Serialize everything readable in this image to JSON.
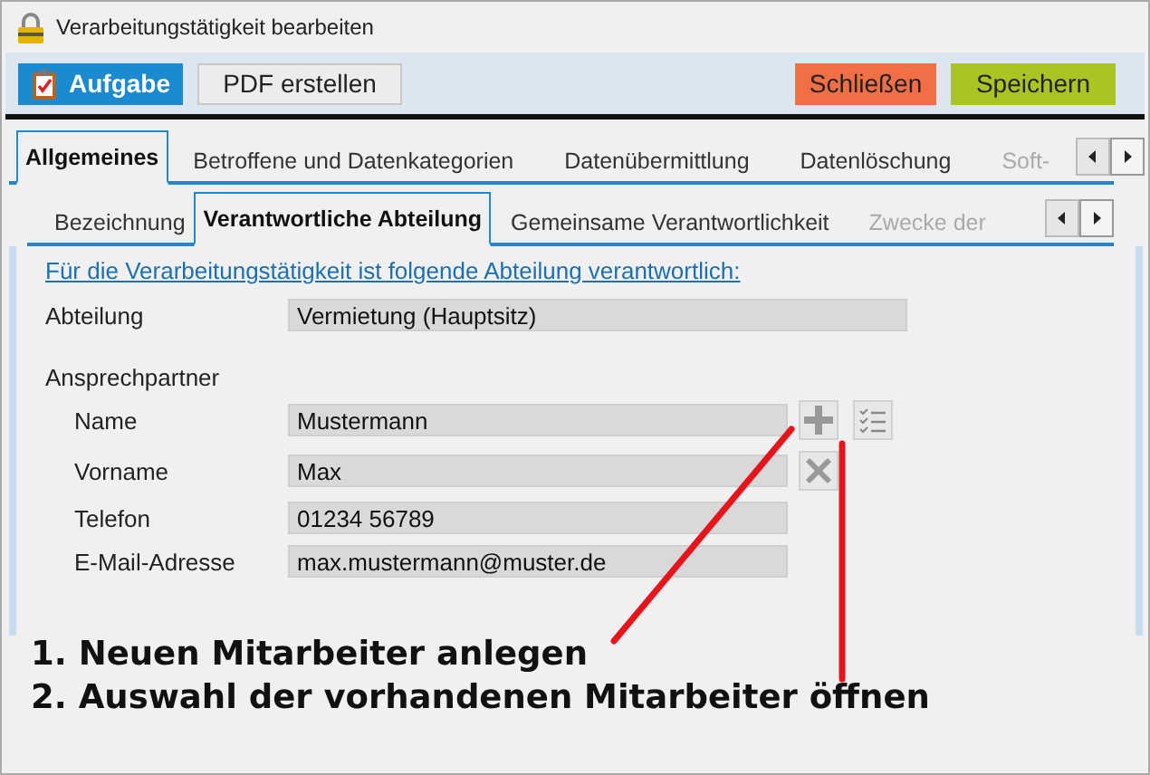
{
  "window": {
    "title": "Verarbeitungstätigkeit bearbeiten"
  },
  "toolbar": [
    {
      "kind": "task",
      "label": "Aufgabe"
    },
    {
      "kind": "plain",
      "label": "PDF erstellen"
    },
    {
      "kind": "spacer"
    },
    {
      "kind": "close",
      "label": "Schließen"
    },
    {
      "kind": "save",
      "label": "Speichern"
    }
  ],
  "tabs": [
    {
      "label": "Allgemeines",
      "selected": true,
      "disabled": false
    },
    {
      "label": "Betroffene und Datenkategorien",
      "selected": false,
      "disabled": false
    },
    {
      "label": "Datenübermittlung",
      "selected": false,
      "disabled": false
    },
    {
      "label": "Datenlöschung",
      "selected": false,
      "disabled": false
    },
    {
      "label": "Soft-",
      "selected": false,
      "disabled": true
    }
  ],
  "subtabs": [
    {
      "label": "Bezeichnung",
      "selected": false,
      "disabled": false
    },
    {
      "label": "Verantwortliche Abteilung",
      "selected": true,
      "disabled": false
    },
    {
      "label": "Gemeinsame Verantwortlichkeit",
      "selected": false,
      "disabled": false
    },
    {
      "label": "Zwecke der",
      "selected": false,
      "disabled": true
    }
  ],
  "form": {
    "heading": "Für die Verarbeitungstätigkeit ist folgende Abteilung verantwortlich:",
    "department": {
      "label": "Abteilung",
      "value": "Vermietung (Hauptsitz)"
    },
    "contact_heading": "Ansprechpartner",
    "contact_fields": [
      {
        "label": "Name",
        "value": "Mustermann",
        "buttons": [
          {
            "kind": "add"
          },
          {
            "kind": "list"
          }
        ]
      },
      {
        "label": "Vorname",
        "value": "Max",
        "buttons": [
          {
            "kind": "clear"
          }
        ]
      },
      {
        "label": "Telefon",
        "value": "01234 56789"
      },
      {
        "label": "E-Mail-Adresse",
        "value": "max.mustermann@muster.de"
      }
    ]
  },
  "annotations": [
    "1. Neuen Mitarbeiter anlegen",
    "2. Auswahl der vorhandenen Mitarbeiter öffnen"
  ]
}
